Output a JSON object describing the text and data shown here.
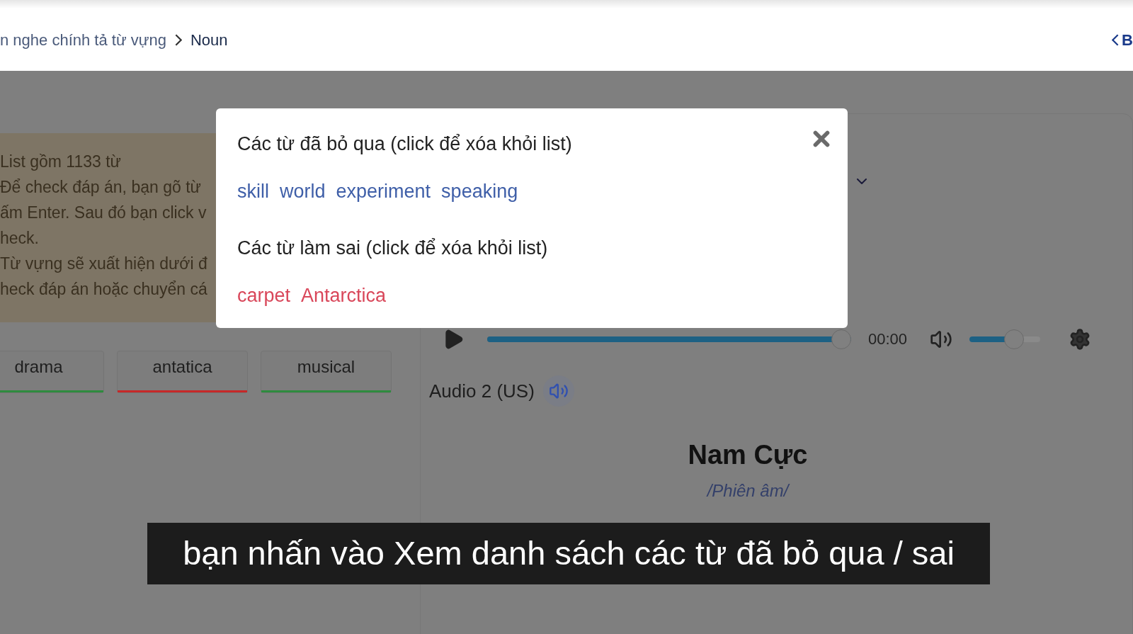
{
  "breadcrumb": [
    {
      "label": "n nghe chính tả từ vựng",
      "current": false
    },
    {
      "label": "Noun",
      "current": true
    }
  ],
  "back_link": "B",
  "info_lines": [
    "List gồm 1133 từ",
    "Để check đáp án, bạn gõ từ",
    "ấm Enter. Sau đó bạn click v",
    "heck.",
    "Từ vựng sẽ xuất hiện dưới đ",
    "heck đáp án hoặc chuyển cá"
  ],
  "chips": [
    {
      "label": "drama",
      "color": "#2e8b3e"
    },
    {
      "label": "antatica",
      "color": "#c62828"
    },
    {
      "label": "musical",
      "color": "#2e8b3e"
    }
  ],
  "player": {
    "time": "00:00",
    "progress": {
      "level": 1.0
    },
    "volume": {
      "level": 0.68
    }
  },
  "audio_label": "Audio 2 (US)",
  "word": "Nam Cực",
  "phonetic": "/Phiên âm/",
  "modal": {
    "sections": [
      {
        "kind": "skipped",
        "title": "Các từ đã bỏ qua (click để xóa khỏi list)",
        "words": [
          "skill",
          "world",
          "experiment",
          "speaking"
        ]
      },
      {
        "kind": "wrong",
        "title": "Các từ làm sai (click để xóa khỏi list)",
        "words": [
          "carpet",
          "Antarctica"
        ]
      }
    ]
  },
  "subtitle": "bạn nhấn vào Xem danh sách các từ đã bỏ qua / sai"
}
